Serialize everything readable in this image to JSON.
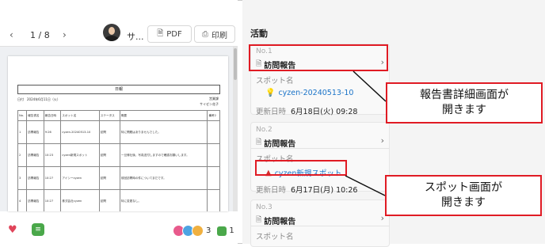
{
  "viewer": {
    "page_info": "1 / 8",
    "username": "サ...",
    "pdf_label": "PDF",
    "print_label": "印刷",
    "prev_icon": "‹",
    "next_icon": "›"
  },
  "document": {
    "title": "日報",
    "meta_left": "日付　2024年6月11日（火）",
    "meta_right_line1": "営業課",
    "meta_right_line2": "サイゼン花子",
    "columns": [
      "No.",
      "報告書名",
      "報告日時",
      "スポット名",
      "ステータス",
      "概要",
      "備考2"
    ],
    "rows": [
      [
        "1",
        "訪問報告",
        "9:26",
        "cyzen-20240513-10",
        "訪問",
        "特に問題はありませんでした。",
        ""
      ],
      [
        "2",
        "訪問報告",
        "10:23",
        "cyzen新規スポット",
        "訪問",
        "一旦帰社後、写真送付しますので確認お願いします。",
        ""
      ],
      [
        "3",
        "訪問報告",
        "10:27",
        "アイシーcyzen",
        "訪問",
        "前回訪問時の件についてまだです。",
        ""
      ],
      [
        "4",
        "訪問報告",
        "10:27",
        "株式会社cyzen",
        "訪問",
        "特に変更なし。",
        ""
      ]
    ]
  },
  "footer": {
    "reaction_count": "3",
    "comment_count": "1"
  },
  "activity": {
    "title": "活動",
    "cards": [
      {
        "no": "No.1",
        "report": "訪問報告",
        "spot_label": "スポット名",
        "spot_name": "cyzen-20240513-10",
        "date_label": "更新日時",
        "date_value": "6月18日(火) 09:28"
      },
      {
        "no": "No.2",
        "report": "訪問報告",
        "spot_label": "スポット名",
        "spot_name": "cyzen新規スポット",
        "date_label": "更新日時",
        "date_value": "6月17日(月) 10:26"
      },
      {
        "no": "No.3",
        "report": "訪問報告",
        "spot_label": "スポット名"
      }
    ]
  },
  "annotations": {
    "callout1_line1": "報告書詳細画面が",
    "callout1_line2": "開きます",
    "callout2_line1": "スポット画面が",
    "callout2_line2": "開きます"
  },
  "colors": {
    "annotation_red": "#e01b24",
    "link_blue": "#1a73c8",
    "heart_red": "#e0445a",
    "comment_green": "#4aa84a"
  }
}
